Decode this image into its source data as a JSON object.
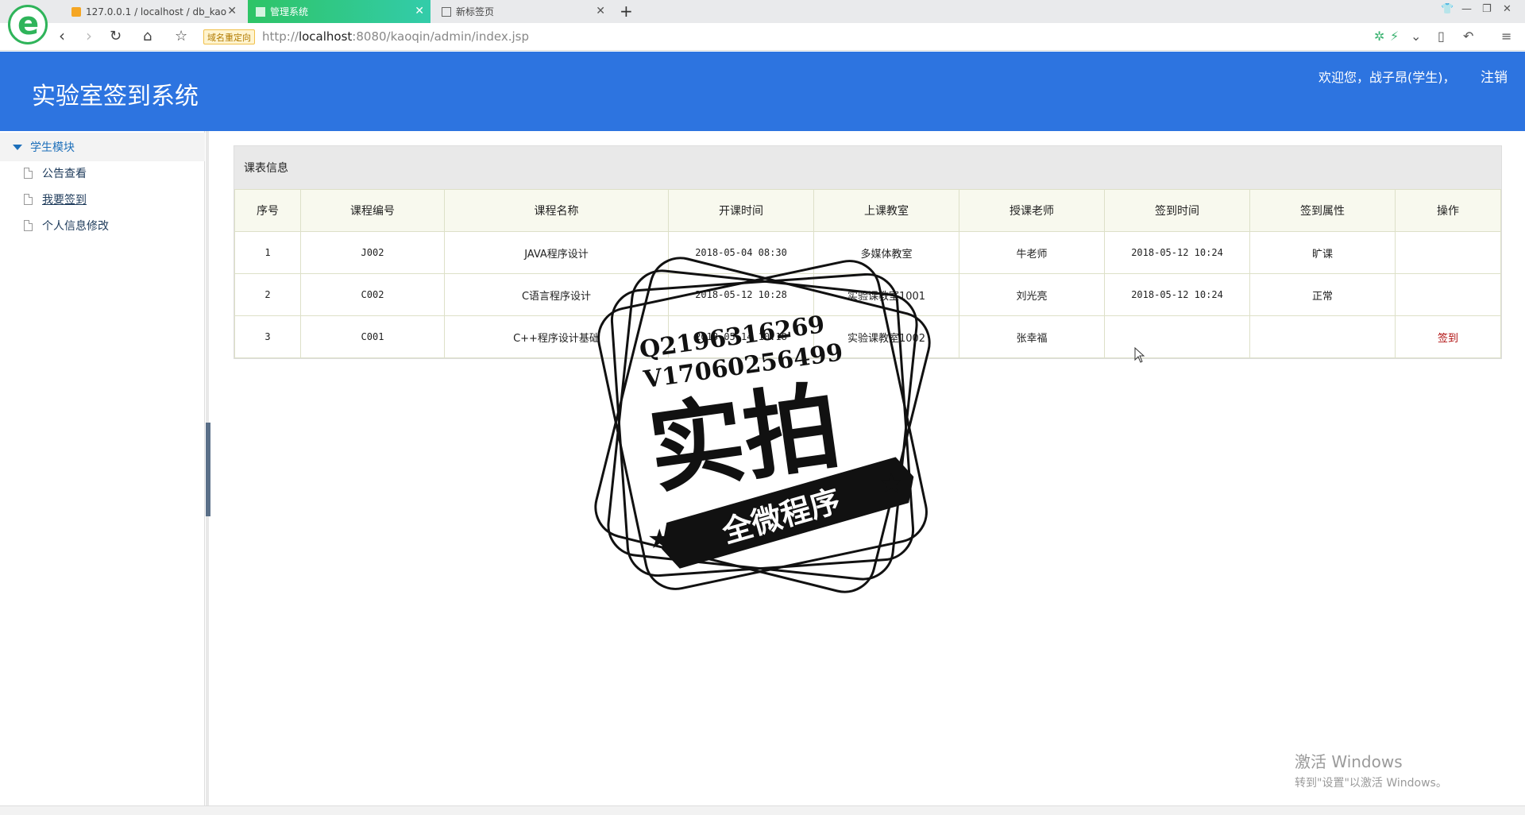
{
  "browser": {
    "tabs": [
      {
        "label": "127.0.0.1 / localhost / db_kao",
        "favicon": "pma-icon",
        "active": false
      },
      {
        "label": "管理系统",
        "favicon": "page-icon",
        "active": true
      },
      {
        "label": "新标签页",
        "favicon": "grid-icon",
        "active": false
      }
    ],
    "new_tab": "+",
    "redirect_badge": "域名重定向",
    "url_prefix": "http://",
    "url_host": "localhost",
    "url_rest": ":8080/kaoqin/admin/index.jsp"
  },
  "header": {
    "title": "实验室签到系统",
    "welcome": "欢迎您，战子昂(学生)，",
    "logout": "注销",
    "bg_color": "#2d74e0"
  },
  "sidebar": {
    "module": "学生模块",
    "items": [
      {
        "label": "公告查看"
      },
      {
        "label": "我要签到"
      },
      {
        "label": "个人信息修改"
      }
    ]
  },
  "panel": {
    "title": "课表信息",
    "columns": [
      "序号",
      "课程编号",
      "课程名称",
      "开课时间",
      "上课教室",
      "授课老师",
      "签到时间",
      "签到属性",
      "操作"
    ],
    "rows": [
      [
        "1",
        "J002",
        "JAVA程序设计",
        "2018-05-04 08:30",
        "多媒体教室",
        "牛老师",
        "2018-05-12 10:24",
        "旷课",
        ""
      ],
      [
        "2",
        "C002",
        "C语言程序设计",
        "2018-05-12 10:28",
        "实验课教室1001",
        "刘光亮",
        "2018-05-12 10:24",
        "正常",
        ""
      ],
      [
        "3",
        "C001",
        "C++程序设计基础",
        "2018-05-14 10:18",
        "实验课教室1002",
        "张幸福",
        "",
        "",
        "签到"
      ]
    ]
  },
  "watermark": {
    "line1": "Q2196316269",
    "line2": "V17060256499",
    "big": "实拍",
    "ribbon": "全微程序"
  },
  "windows_activation": {
    "line1": "激活 Windows",
    "line2": "转到\"设置\"以激活 Windows。"
  }
}
